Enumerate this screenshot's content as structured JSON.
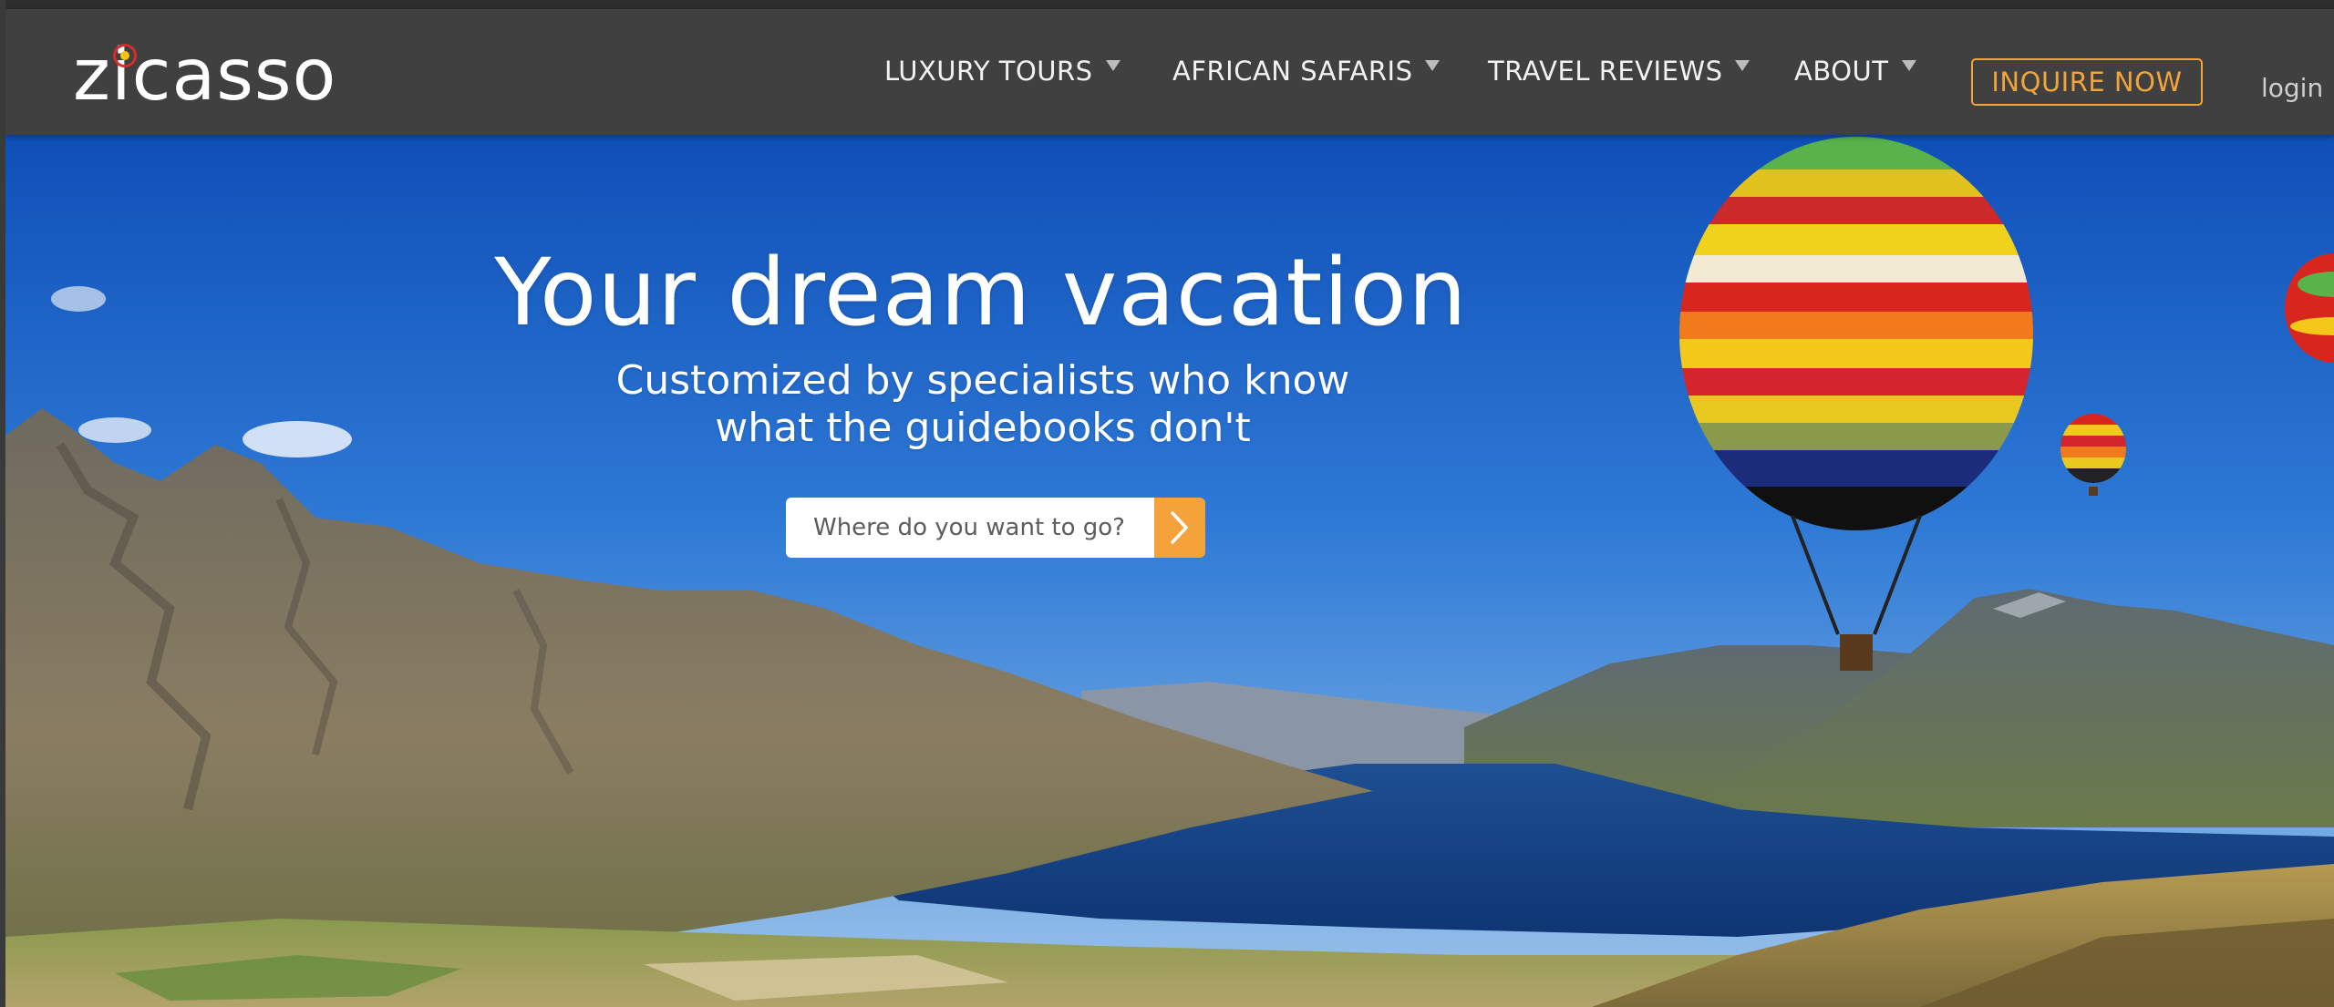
{
  "brand": {
    "name": "zicasso",
    "accent": "#f2a33a"
  },
  "nav": {
    "items": [
      {
        "label": "LUXURY TOURS"
      },
      {
        "label": "AFRICAN SAFARIS"
      },
      {
        "label": "TRAVEL REVIEWS"
      },
      {
        "label": "ABOUT"
      }
    ],
    "inquire_label": "INQUIRE NOW",
    "login_label": "login"
  },
  "hero": {
    "title": "Your dream vacation",
    "subtitle": "Customized by specialists who know what the guidebooks don't",
    "search": {
      "placeholder": "Where do you want to go?",
      "submit_icon": "chevron-right-icon"
    }
  }
}
